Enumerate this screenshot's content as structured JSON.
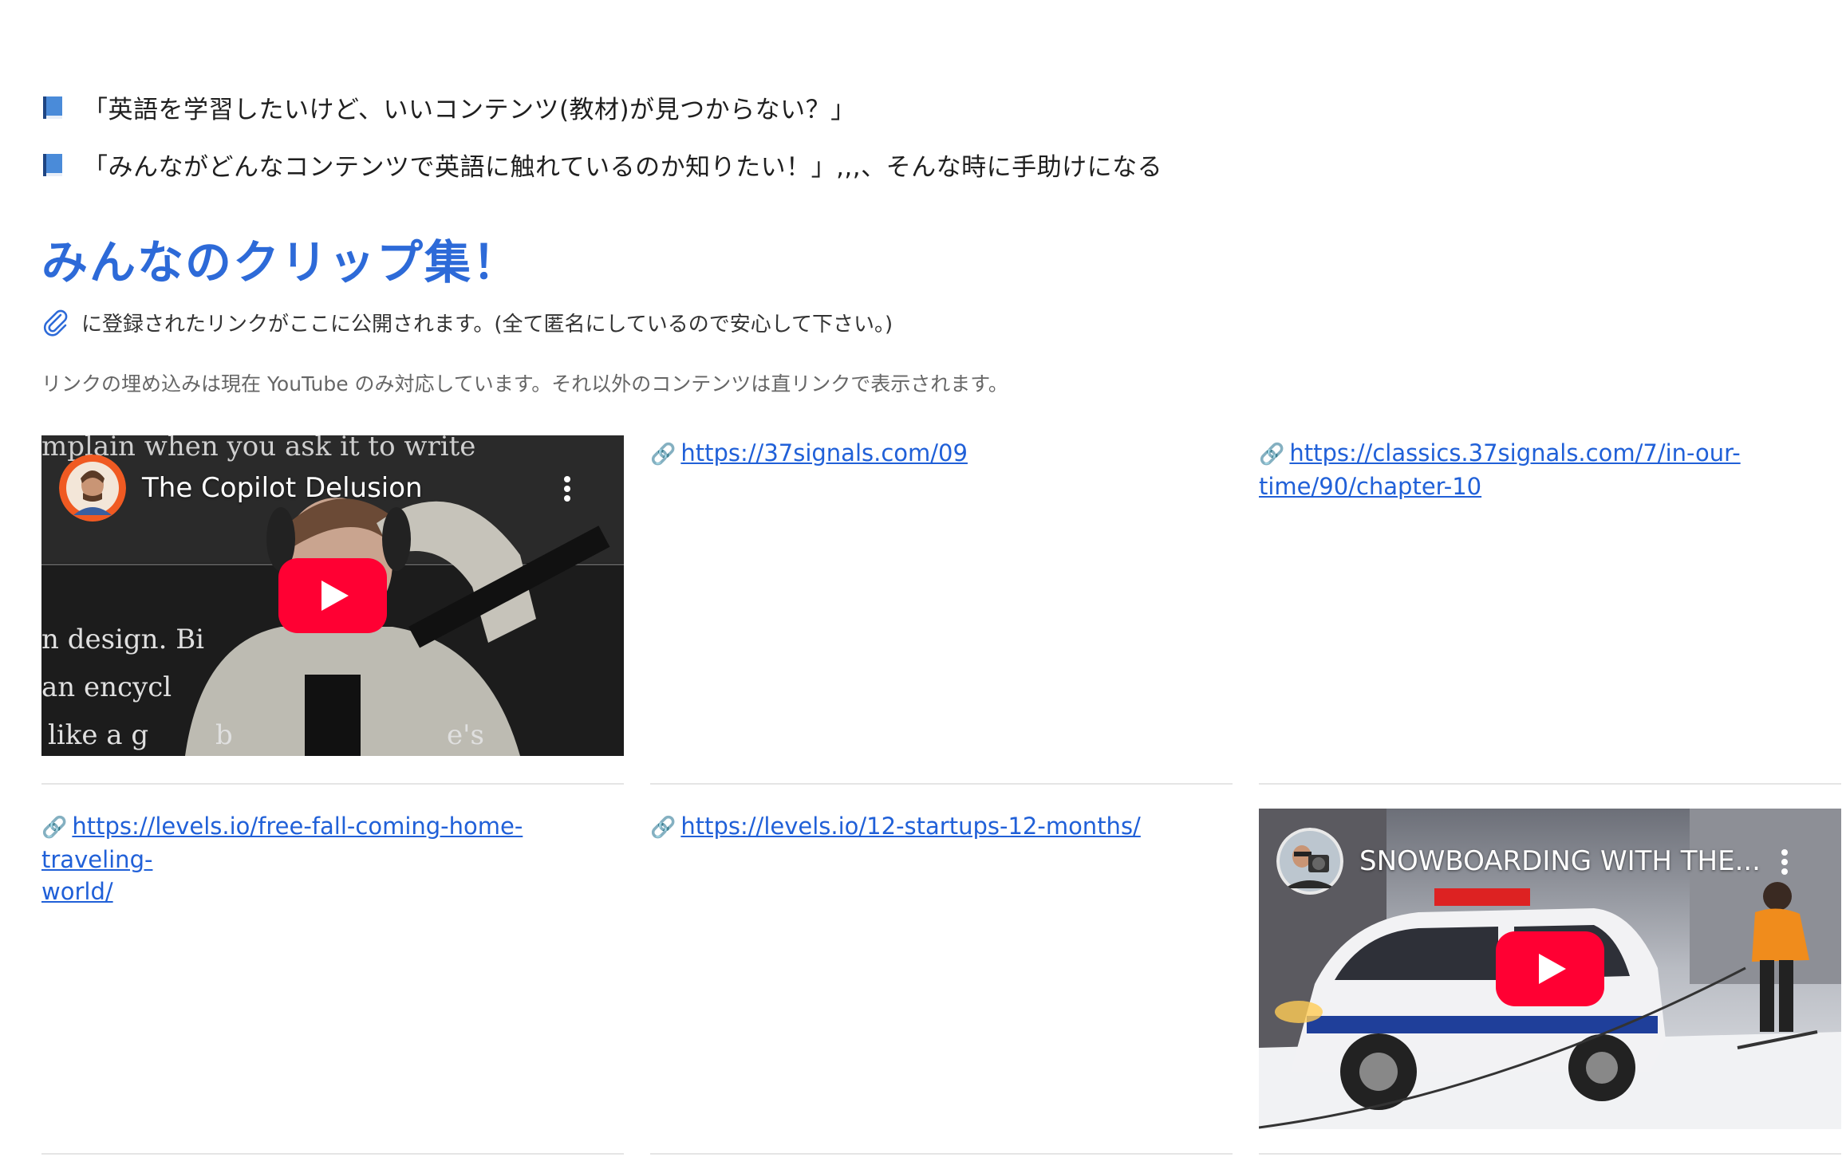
{
  "intro": {
    "line1": "「英語を学習したいけど、いいコンテンツ(教材)が見つからない？」",
    "line2": "「みんながどんなコンテンツで英語に触れているのか知りたい！」,,,、そんな時に手助けになる"
  },
  "heading": "みんなのクリップ集！",
  "note": "に登録されたリンクがここに公開されます。(全て匿名にしているので安心して下さい。)",
  "sub_note": "リンクの埋め込みは現在 YouTube のみ対応しています。それ以外のコンテンツは直リンクで表示されます。",
  "cards": [
    {
      "type": "video",
      "title": "The Copilot Delusion",
      "overlay_text": [
        "mplain when you ask it to write",
        "n design. Bi",
        "an encycl",
        "like a g",
        "b",
        "e's"
      ]
    },
    {
      "type": "link",
      "url": "https://37signals.com/09"
    },
    {
      "type": "link",
      "url_line1": "https://classics.37signals.com/7/in-our-",
      "url_line2": "time/90/chapter-10"
    },
    {
      "type": "link",
      "url_line1": "https://levels.io/free-fall-coming-home-traveling-",
      "url_line2": "world/"
    },
    {
      "type": "link",
      "url": "https://levels.io/12-startups-12-months/"
    },
    {
      "type": "video",
      "title": "SNOWBOARDING WITH THE..."
    }
  ],
  "icons": {
    "book": "blue-book-icon",
    "clip": "paperclip-icon",
    "link": "link-icon"
  },
  "colors": {
    "heading": "#2d6ad8",
    "link": "#2060d8",
    "youtube_red": "#ff0033"
  }
}
